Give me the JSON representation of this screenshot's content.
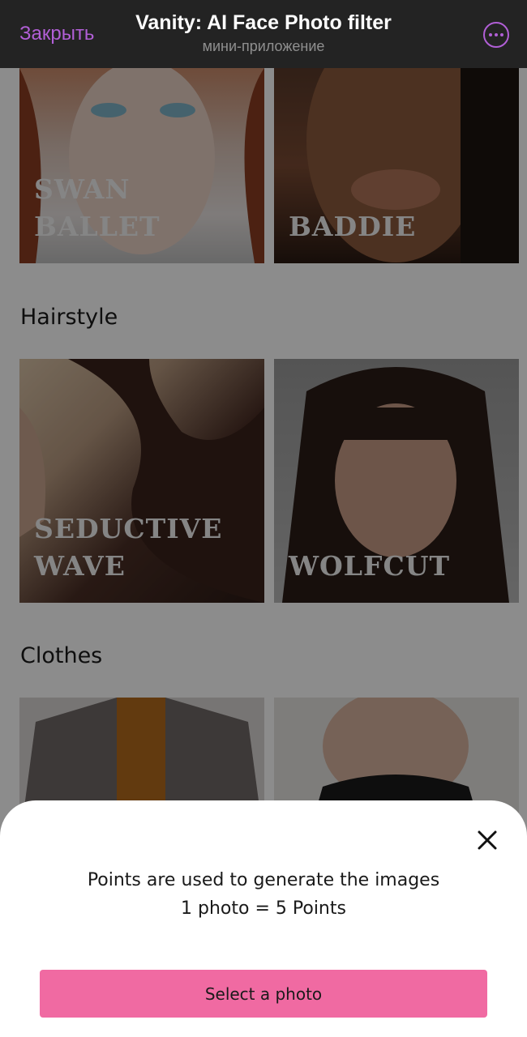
{
  "topbar": {
    "close_label": "Закрыть",
    "title": "Vanity: AI Face Photo filter",
    "subtitle": "мини-приложение",
    "more_icon": "ellipsis-circle-icon",
    "accent_color": "#b15fd6"
  },
  "sections": {
    "makeup_cards": [
      {
        "label": "SWAN BALLET"
      },
      {
        "label": "BADDIE"
      }
    ],
    "hairstyle": {
      "title": "Hairstyle",
      "cards": [
        {
          "label": "SEDUCTIVE WAVE"
        },
        {
          "label": "WOLFCUT"
        }
      ]
    },
    "clothes": {
      "title": "Clothes"
    }
  },
  "sheet": {
    "close_icon": "close-icon",
    "line1": "Points are used to generate the images",
    "line2": "1 photo = 5 Points",
    "button_label": "Select a photo",
    "button_color": "#f06aa2"
  }
}
